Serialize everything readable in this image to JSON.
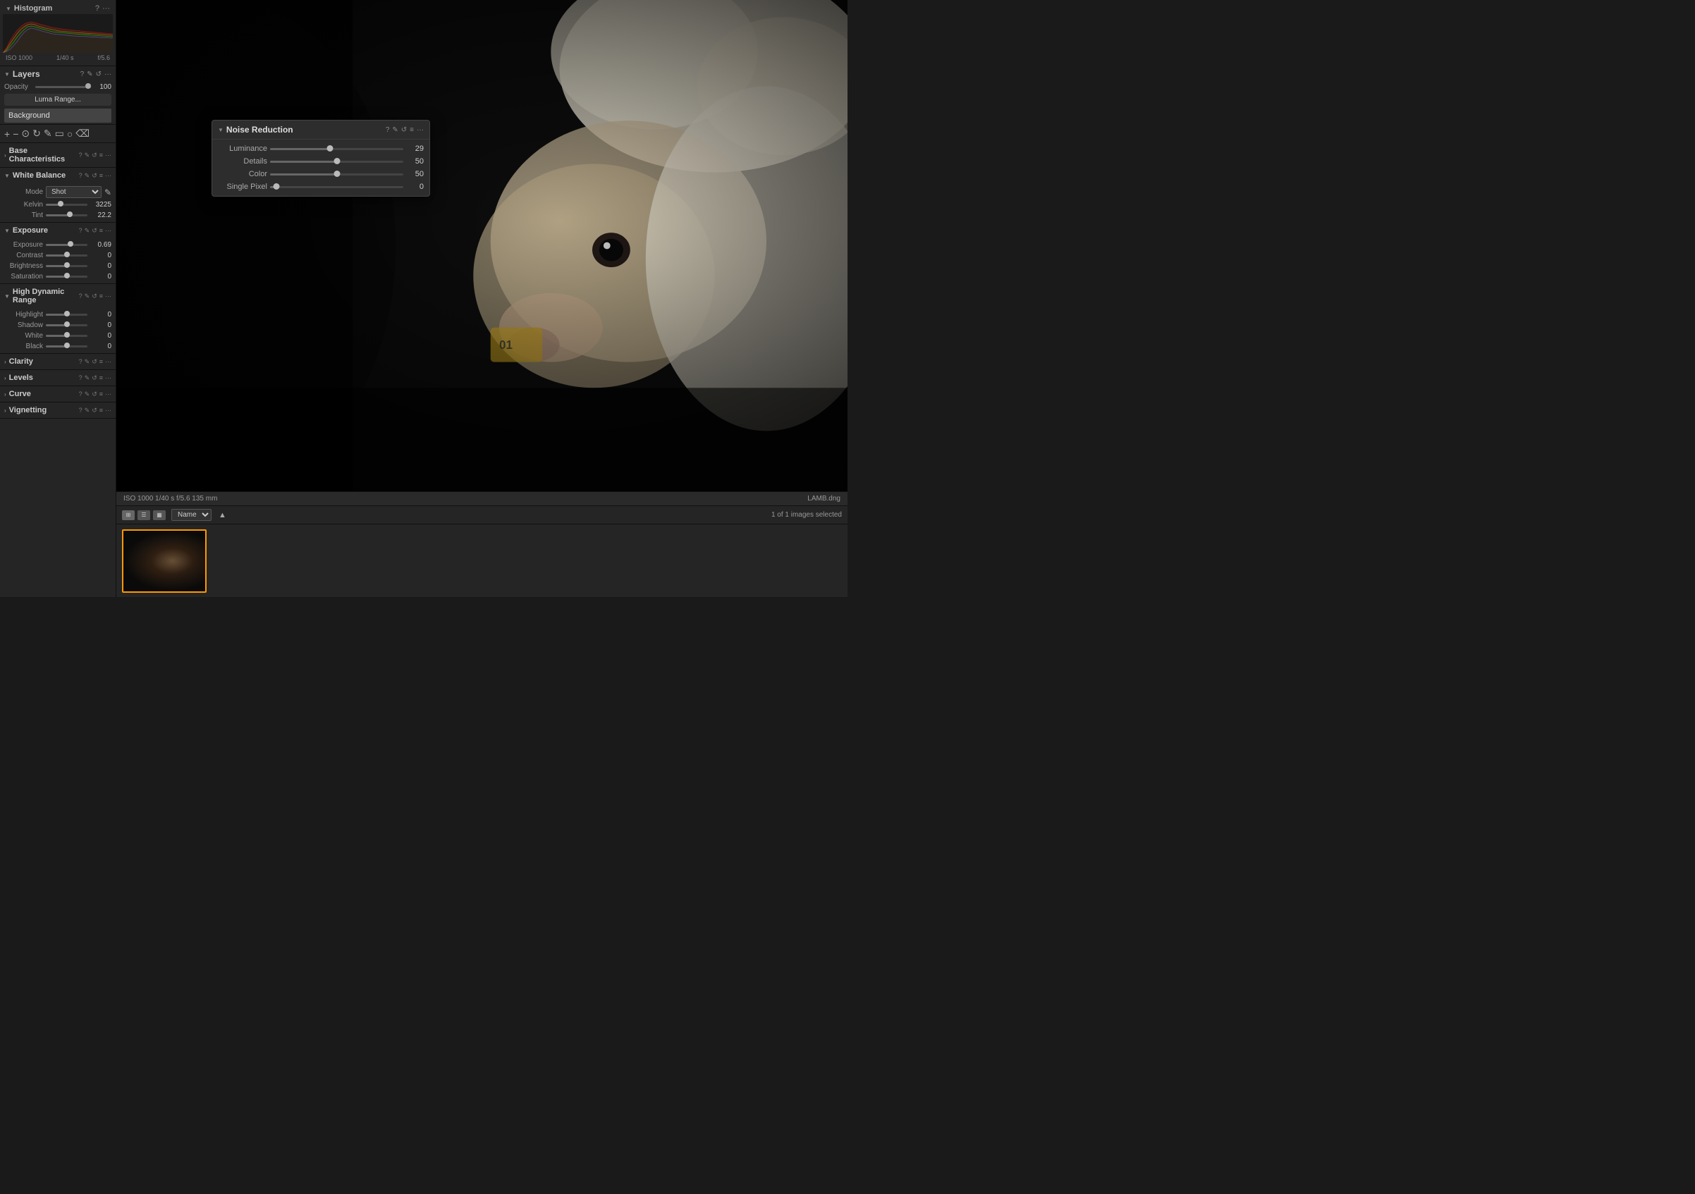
{
  "histogram": {
    "title": "Histogram",
    "meta": [
      "ISO 1000",
      "1/40 s",
      "f/5.6"
    ]
  },
  "layers": {
    "title": "Layers",
    "opacity_label": "Opacity",
    "opacity_value": "100",
    "luma_range_btn": "Luma Range...",
    "background_item": "Background"
  },
  "noise_reduction": {
    "title": "Noise Reduction",
    "sliders": [
      {
        "label": "Luminance",
        "value": 29,
        "pct": 45
      },
      {
        "label": "Details",
        "value": 50,
        "pct": 50
      },
      {
        "label": "Color",
        "value": 50,
        "pct": 50
      },
      {
        "label": "Single Pixel",
        "value": 0,
        "pct": 5
      }
    ]
  },
  "base_characteristics": {
    "title": "Base Characteristics"
  },
  "white_balance": {
    "title": "White Balance",
    "mode_label": "Mode",
    "mode_value": "Shot",
    "kelvin_label": "Kelvin",
    "kelvin_value": "3225",
    "kelvin_pct": 35,
    "tint_label": "Tint",
    "tint_value": "22.2",
    "tint_pct": 58
  },
  "exposure": {
    "title": "Exposure",
    "sliders": [
      {
        "label": "Exposure",
        "value": "0.69",
        "pct": 60
      },
      {
        "label": "Contrast",
        "value": "0",
        "pct": 50
      },
      {
        "label": "Brightness",
        "value": "0",
        "pct": 50
      },
      {
        "label": "Saturation",
        "value": "0",
        "pct": 50
      }
    ]
  },
  "hdr": {
    "title": "High Dynamic Range",
    "sliders": [
      {
        "label": "Highlight",
        "value": "0",
        "pct": 50
      },
      {
        "label": "Shadow",
        "value": "0",
        "pct": 50
      },
      {
        "label": "White",
        "value": "0",
        "pct": 50
      },
      {
        "label": "Black",
        "value": "0",
        "pct": 50
      }
    ]
  },
  "clarity": {
    "title": "Clarity"
  },
  "levels": {
    "title": "Levels"
  },
  "curve": {
    "title": "Curve"
  },
  "vignetting": {
    "title": "Vignetting"
  },
  "status_bar": {
    "meta": "ISO 1000   1/40 s   f/5.6   135 mm",
    "filename": "LAMB.dng"
  },
  "filmstrip": {
    "sort_label": "Name",
    "images_count": "1 of 1 images selected"
  }
}
